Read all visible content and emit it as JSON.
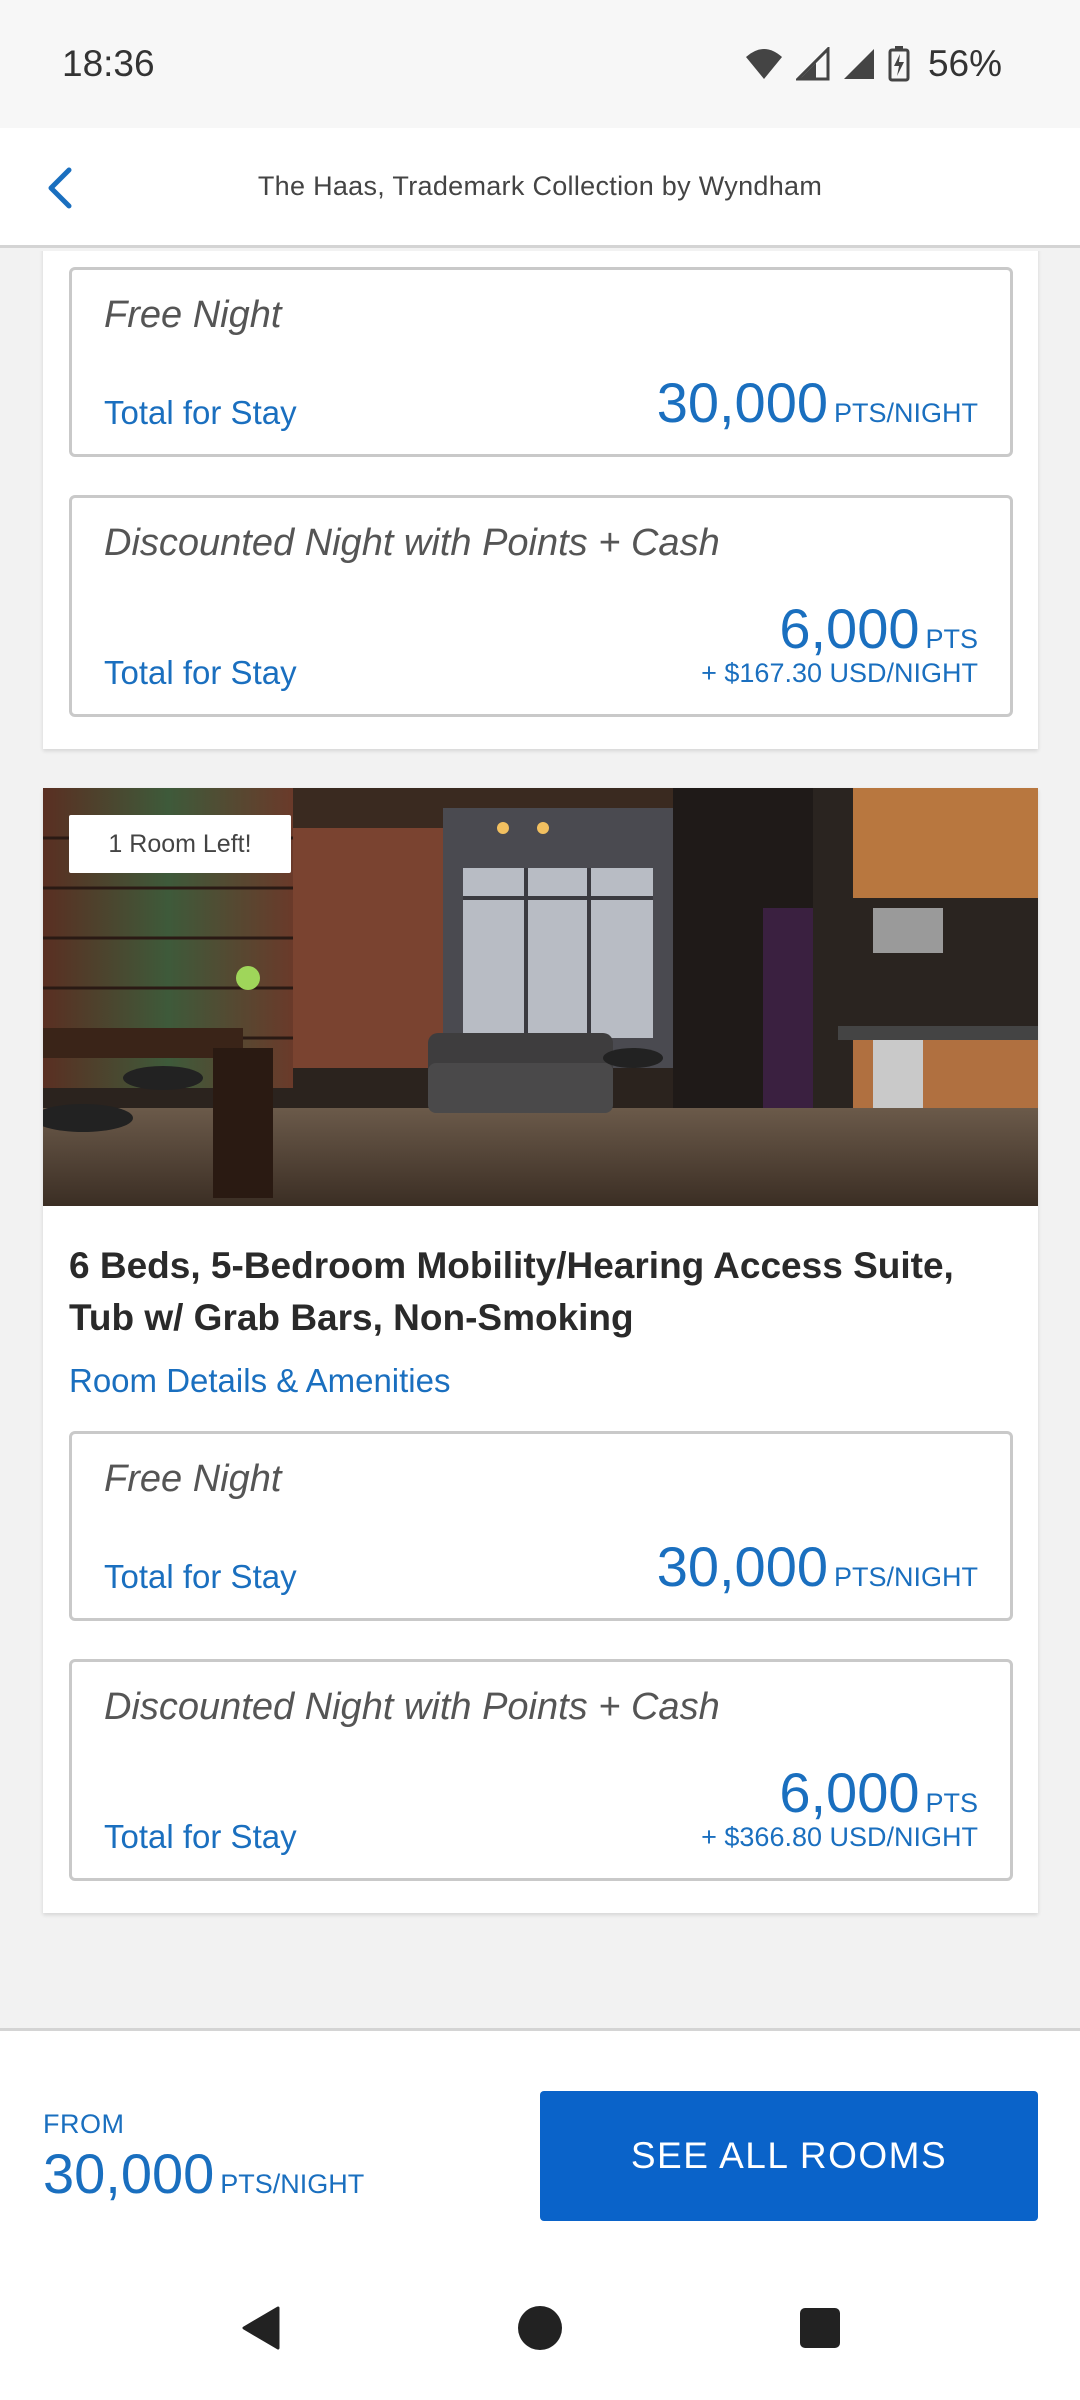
{
  "status_bar": {
    "time": "18:36",
    "battery": "56%"
  },
  "header": {
    "title": "The Haas, Trademark Collection by Wyndham"
  },
  "top_card": {
    "free_night": {
      "name": "Free Night",
      "total_label": "Total for Stay",
      "points": "30,000",
      "unit": "PTS/NIGHT"
    },
    "discounted": {
      "name": "Discounted Night with Points + Cash",
      "total_label": "Total for Stay",
      "points": "6,000",
      "unit": "PTS",
      "cash": "+ $167.30 USD/NIGHT"
    }
  },
  "room_card": {
    "badge": "1 Room Left!",
    "title": "6 Beds, 5-Bedroom Mobility/Hearing Access Suite, Tub w/ Grab Bars, Non-Smoking",
    "details_link": "Room Details & Amenities",
    "free_night": {
      "name": "Free Night",
      "total_label": "Total for Stay",
      "points": "30,000",
      "unit": "PTS/NIGHT"
    },
    "discounted": {
      "name": "Discounted Night with Points + Cash",
      "total_label": "Total for Stay",
      "points": "6,000",
      "unit": "PTS",
      "cash": "+ $366.80 USD/NIGHT"
    }
  },
  "bottom_bar": {
    "from_label": "FROM",
    "from_points": "30,000",
    "from_unit": "PTS/NIGHT",
    "cta": "SEE ALL ROOMS"
  },
  "icons": {
    "back": "chevron-left-icon",
    "wifi": "wifi-icon",
    "signal": "signal-icon",
    "battery": "battery-charging-icon",
    "nav_back": "nav-back-icon",
    "nav_home": "nav-home-icon",
    "nav_recents": "nav-recents-icon"
  },
  "colors": {
    "accent": "#1a6fbf",
    "cta": "#0a63c9"
  }
}
